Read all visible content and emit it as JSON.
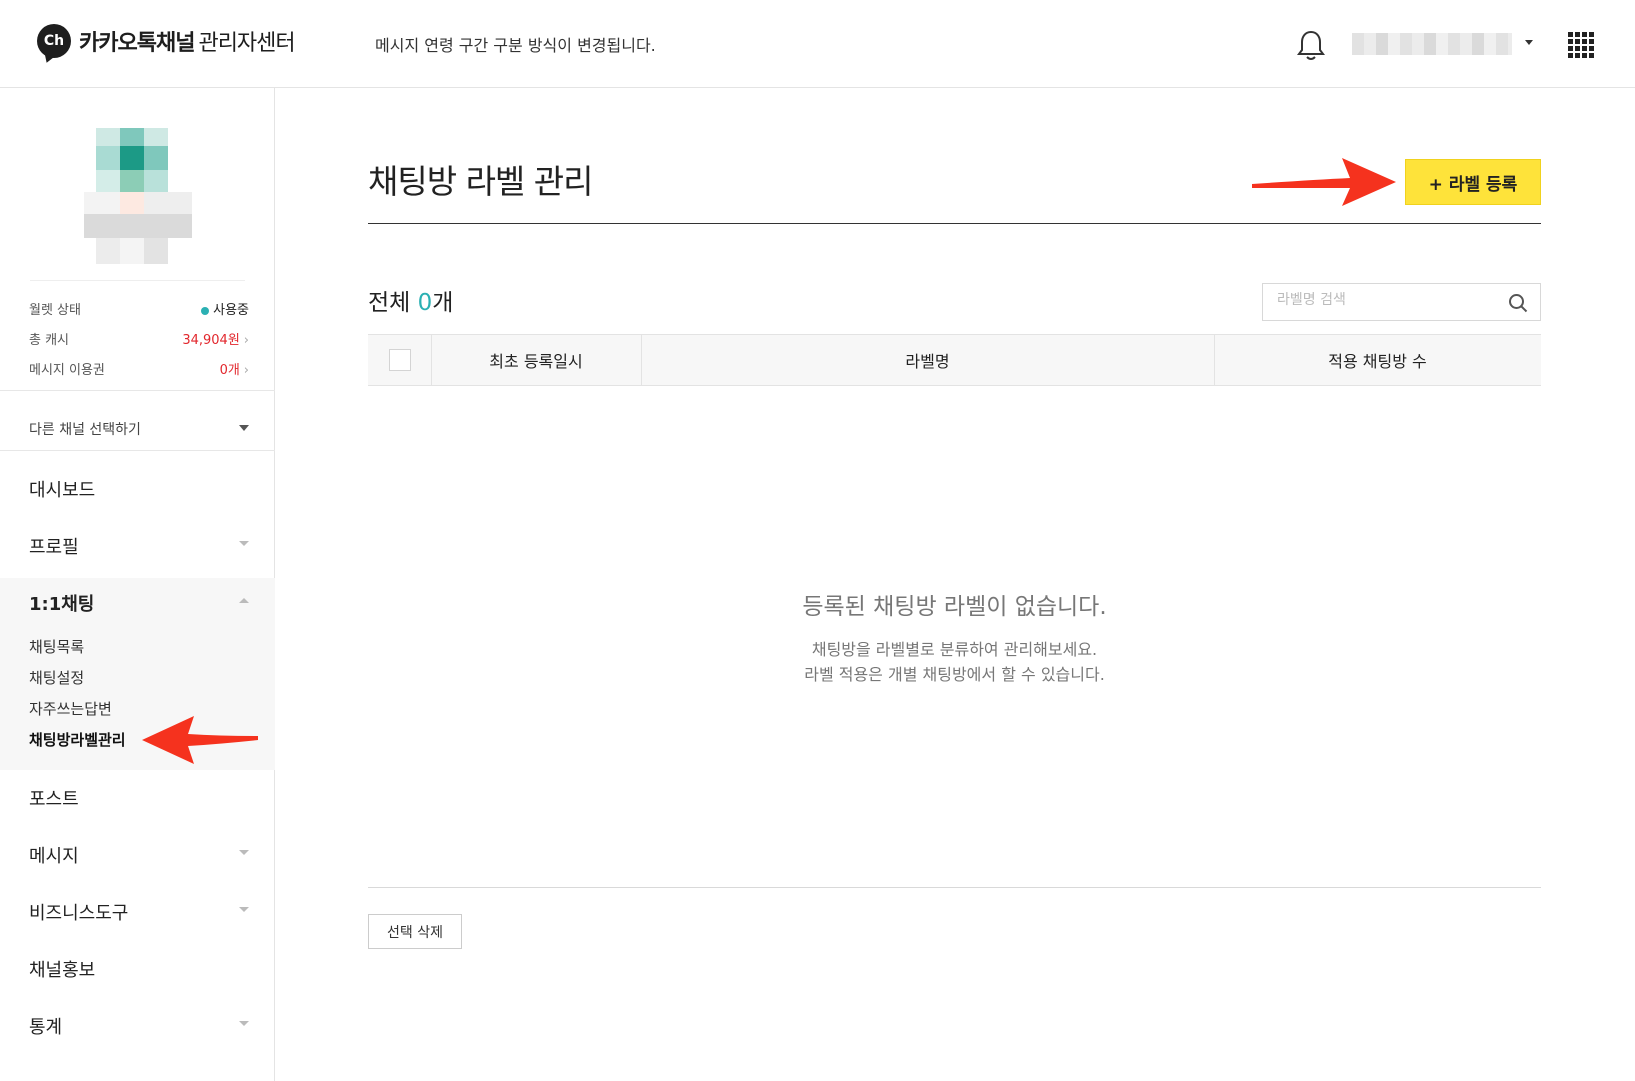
{
  "header": {
    "logo_badge": "Ch",
    "logo_main": "카카오톡채널",
    "logo_sub": "관리자센터",
    "notice": "메시지 연령 구간 구분 방식이 변경됩니다."
  },
  "sidebar": {
    "wallet": [
      {
        "label": "월렛 상태",
        "value": "사용중"
      },
      {
        "label": "총 캐시",
        "value": "34,904원"
      },
      {
        "label": "메시지 이용권",
        "value": "0개"
      }
    ],
    "other_channel": "다른 채널 선택하기",
    "menu": {
      "dashboard": "대시보드",
      "profile": "프로필",
      "chat": "1:1채팅",
      "chat_sub": [
        "채팅목록",
        "채팅설정",
        "자주쓰는답변",
        "채팅방라벨관리"
      ],
      "post": "포스트",
      "message": "메시지",
      "business_tools": "비즈니스도구",
      "promotion": "채널홍보",
      "stats": "통계"
    }
  },
  "main": {
    "title": "채팅방 라벨 관리",
    "add_button": "+ 라벨 등록",
    "total_label": "전체",
    "total_count": "0",
    "total_unit": "개",
    "search_placeholder": "라벨명 검색",
    "columns": [
      "최초 등록일시",
      "라벨명",
      "적용 채팅방 수"
    ],
    "empty_title": "등록된 채팅방 라벨이 없습니다.",
    "empty_desc": [
      "채팅방을 라벨별로 분류하여 관리해보세요.",
      "라벨 적용은 개별 채팅방에서 할 수 있습니다."
    ],
    "delete_button": "선택 삭제"
  },
  "colors": {
    "accent": "#fee33a",
    "teal": "#2bb0b3",
    "red": "#e2272d",
    "arrow": "#f5321e"
  }
}
